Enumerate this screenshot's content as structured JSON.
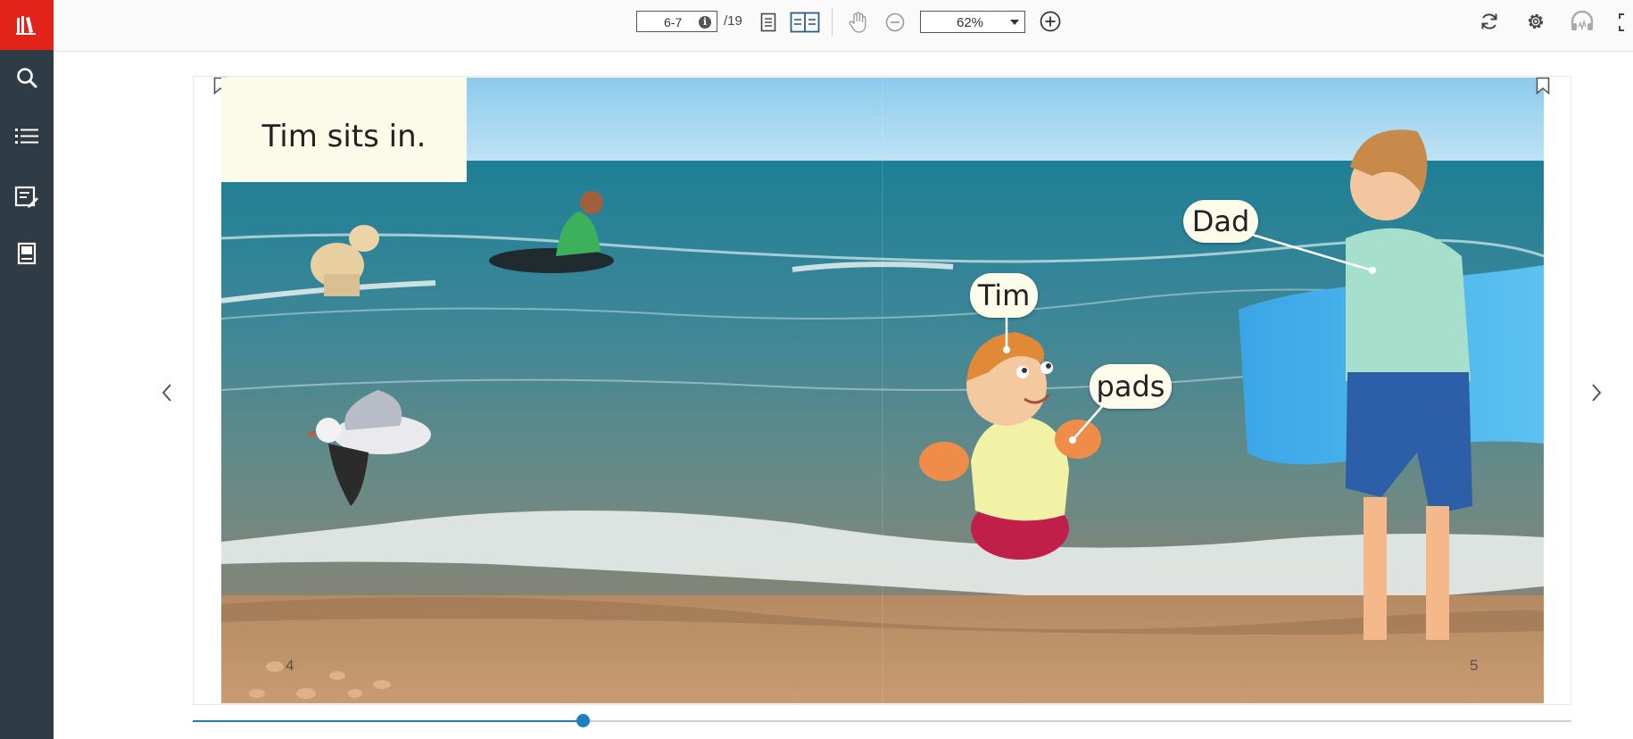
{
  "toolbar": {
    "page_value": "6-7",
    "page_total": "/19",
    "zoom_value": "62%",
    "icons": [
      "info-icon",
      "single-page-icon",
      "double-page-icon",
      "pan-hand-icon",
      "zoom-out-icon",
      "zoom-in-icon",
      "refresh-icon",
      "settings-icon",
      "audio-headphones-icon",
      "fullscreen-icon"
    ]
  },
  "sidebar": {
    "items": [
      "library-logo-icon",
      "search-icon",
      "table-of-contents-icon",
      "notes-icon",
      "book-icon"
    ]
  },
  "book": {
    "caption": "Tim sits in.",
    "labels": {
      "dad": "Dad",
      "tim": "Tim",
      "pads": "pads"
    },
    "left_page_number": "4",
    "right_page_number": "5"
  },
  "progress": {
    "fraction": 0.283
  },
  "colors": {
    "accent": "#1b7fc3",
    "brand_red": "#e2231a",
    "sidebar": "#2f3b45"
  }
}
